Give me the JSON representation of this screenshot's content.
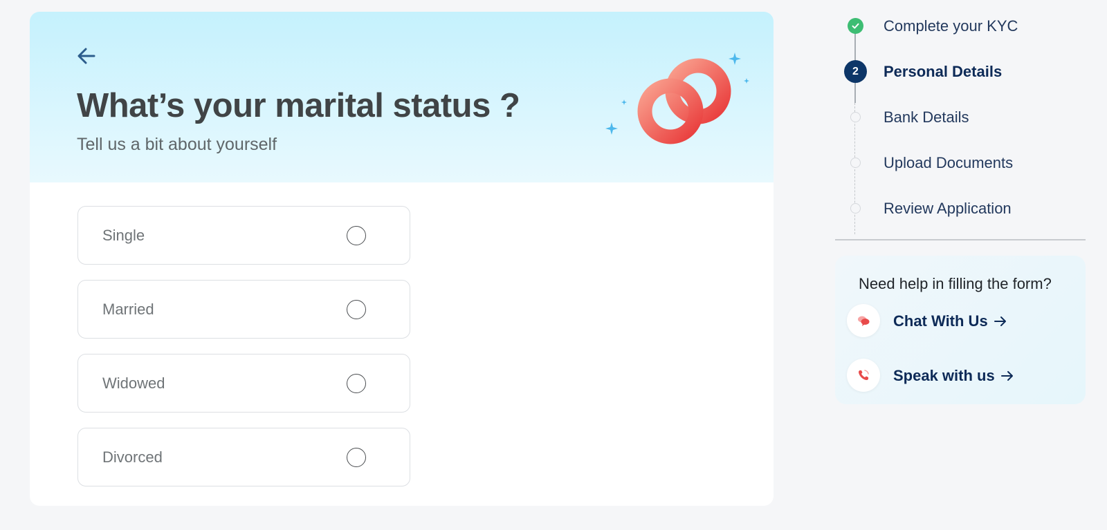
{
  "form": {
    "title": "What’s your marital status ?",
    "subtitle": "Tell us a bit about yourself",
    "options": [
      {
        "label": "Single",
        "selected": false
      },
      {
        "label": "Married",
        "selected": false
      },
      {
        "label": "Widowed",
        "selected": false
      },
      {
        "label": "Divorced",
        "selected": false
      }
    ]
  },
  "stepper": {
    "steps": [
      {
        "label": "Complete your KYC",
        "status": "completed"
      },
      {
        "label": "Personal Details",
        "status": "active",
        "number": "2"
      },
      {
        "label": "Bank Details",
        "status": "pending"
      },
      {
        "label": "Upload Documents",
        "status": "pending"
      },
      {
        "label": "Review Application",
        "status": "pending"
      }
    ]
  },
  "help": {
    "title": "Need help in filling the form?",
    "chat_label": "Chat With Us",
    "speak_label": "Speak with us"
  },
  "colors": {
    "primary": "#0d2a57",
    "success": "#3dbd73",
    "ring": "#f05d5d",
    "sparkle": "#4db8ec",
    "header_bg": "#c5f1fd"
  },
  "icons": {
    "back": "arrow-left-icon",
    "completed": "check-icon",
    "chat": "chat-bubbles-icon",
    "speak": "phone-icon",
    "link_arrow": "arrow-right-icon"
  }
}
